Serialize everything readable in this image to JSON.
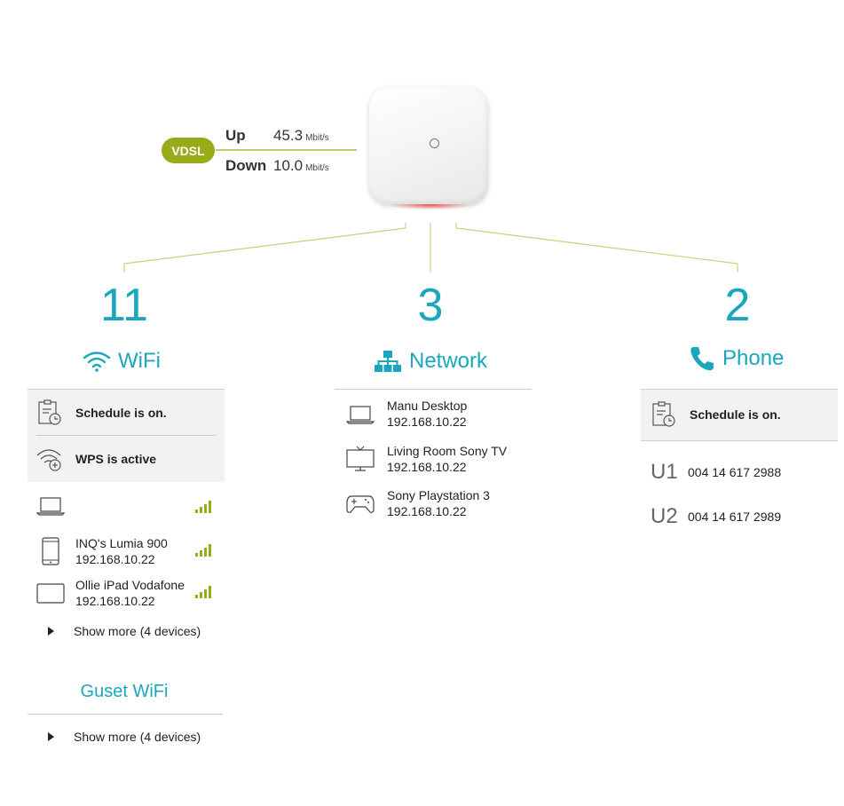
{
  "connection": {
    "type_label": "VDSL",
    "up_label": "Up",
    "up_value": "45.3",
    "up_unit": "Mbit/s",
    "down_label": "Down",
    "down_value": "10.0",
    "down_unit": "Mbit/s"
  },
  "wifi": {
    "count": "11",
    "title": "WiFi",
    "schedule_status": "Schedule is on.",
    "wps_status": "WPS is active",
    "devices": [
      {
        "name": "",
        "ip": "",
        "icon": "laptop-icon",
        "signal": 4
      },
      {
        "name": "INQ's Lumia 900",
        "ip": "192.168.10.22",
        "icon": "smartphone-icon",
        "signal": 4
      },
      {
        "name": "Ollie iPad Vodafone",
        "ip": "192.168.10.22",
        "icon": "tablet-icon",
        "signal": 4
      }
    ],
    "show_more": "Show more (4 devices)"
  },
  "guest_wifi": {
    "title": "Guset WiFi",
    "show_more": "Show more (4 devices)"
  },
  "network": {
    "count": "3",
    "title": "Network",
    "devices": [
      {
        "name": "Manu Desktop",
        "ip": "192.168.10.22",
        "icon": "laptop-icon"
      },
      {
        "name": "Living Room Sony TV",
        "ip": "192.168.10.22",
        "icon": "tv-icon"
      },
      {
        "name": "Sony Playstation 3",
        "ip": "192.168.10.22",
        "icon": "gamepad-icon"
      }
    ]
  },
  "phone": {
    "count": "2",
    "title": "Phone",
    "schedule_status": "Schedule is on.",
    "lines": [
      {
        "label": "U1",
        "number": "004 14 617 2988"
      },
      {
        "label": "U2",
        "number": "004 14 617 2989"
      }
    ]
  },
  "colors": {
    "accent": "#18a7bd",
    "signal": "#9aab19",
    "connector": "#c4d37a"
  }
}
